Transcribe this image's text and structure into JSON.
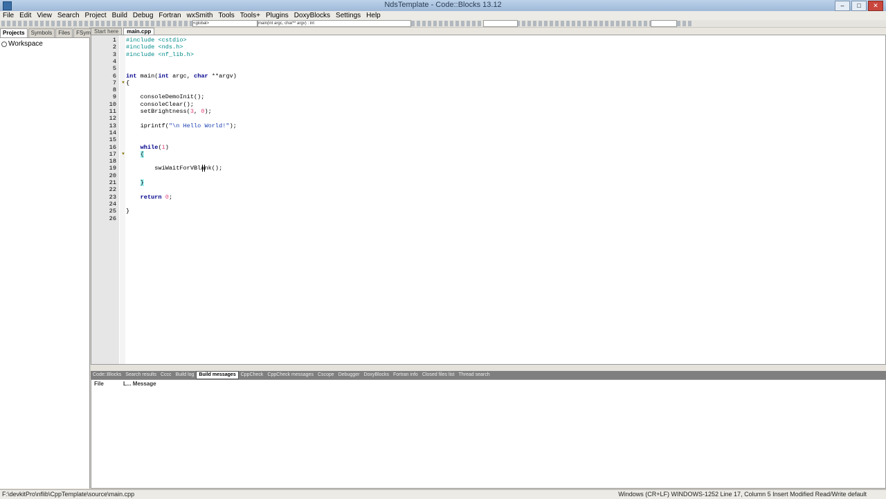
{
  "window": {
    "title": "NdsTemplate - Code::Blocks 13.12",
    "minimize_glyph": "–",
    "maximize_glyph": "□",
    "close_glyph": "✕"
  },
  "menu": [
    "File",
    "Edit",
    "View",
    "Search",
    "Project",
    "Build",
    "Debug",
    "Fortran",
    "wxSmith",
    "Tools",
    "Tools+",
    "Plugins",
    "DoxyBlocks",
    "Settings",
    "Help"
  ],
  "toolbar": {
    "build_target": "<global>",
    "function_combo": "main(int argc, char** argv) : int"
  },
  "left_panel": {
    "tabs": [
      "Projects",
      "Symbols",
      "Files",
      "FSymbols"
    ],
    "active_tab": "Projects",
    "tree_root": "Workspace"
  },
  "editor": {
    "tabs": [
      "Start here",
      "main.cpp"
    ],
    "active_tab": "main.cpp",
    "lines": [
      {
        "n": "1",
        "fold": "",
        "tokens": [
          {
            "c": "pp",
            "t": "#include <cstdio>"
          }
        ]
      },
      {
        "n": "2",
        "fold": "",
        "tokens": [
          {
            "c": "pp",
            "t": "#include <nds.h>"
          }
        ]
      },
      {
        "n": "3",
        "fold": "",
        "tokens": [
          {
            "c": "pp",
            "t": "#include <nf_lib.h>"
          }
        ]
      },
      {
        "n": "4",
        "fold": "",
        "tokens": []
      },
      {
        "n": "5",
        "fold": "",
        "tokens": []
      },
      {
        "n": "6",
        "fold": "",
        "tokens": [
          {
            "c": "kw",
            "t": "int"
          },
          {
            "c": "txt",
            "t": " main("
          },
          {
            "c": "kw",
            "t": "int"
          },
          {
            "c": "txt",
            "t": " argc, "
          },
          {
            "c": "kw",
            "t": "char"
          },
          {
            "c": "txt",
            "t": " **argv)"
          }
        ]
      },
      {
        "n": "7",
        "fold": "▾",
        "tokens": [
          {
            "c": "txt",
            "t": "{"
          }
        ]
      },
      {
        "n": "8",
        "fold": "",
        "tokens": []
      },
      {
        "n": "9",
        "fold": "",
        "tokens": [
          {
            "c": "txt",
            "t": "    consoleDemoInit();"
          }
        ]
      },
      {
        "n": "10",
        "fold": "",
        "tokens": [
          {
            "c": "txt",
            "t": "    consoleClear();"
          }
        ]
      },
      {
        "n": "11",
        "fold": "",
        "tokens": [
          {
            "c": "txt",
            "t": "    setBrightness("
          },
          {
            "c": "num",
            "t": "3"
          },
          {
            "c": "txt",
            "t": ", "
          },
          {
            "c": "num",
            "t": "0"
          },
          {
            "c": "txt",
            "t": ");"
          }
        ]
      },
      {
        "n": "12",
        "fold": "",
        "tokens": []
      },
      {
        "n": "13",
        "fold": "",
        "tokens": [
          {
            "c": "txt",
            "t": "    iprintf("
          },
          {
            "c": "str",
            "t": "\"\\n Hello World!\""
          },
          {
            "c": "txt",
            "t": ");"
          }
        ]
      },
      {
        "n": "14",
        "fold": "",
        "tokens": []
      },
      {
        "n": "15",
        "fold": "",
        "tokens": []
      },
      {
        "n": "16",
        "fold": "",
        "tokens": [
          {
            "c": "txt",
            "t": "    "
          },
          {
            "c": "kw",
            "t": "while"
          },
          {
            "c": "txt",
            "t": "("
          },
          {
            "c": "num",
            "t": "1"
          },
          {
            "c": "txt",
            "t": ")"
          }
        ]
      },
      {
        "n": "17",
        "fold": "▾",
        "tokens": [
          {
            "c": "txt",
            "t": "    "
          },
          {
            "c": "brace",
            "t": "{"
          }
        ]
      },
      {
        "n": "18",
        "fold": "",
        "tokens": []
      },
      {
        "n": "19",
        "fold": "",
        "tokens": [
          {
            "c": "txt",
            "t": "        swiWaitForVBlank();"
          }
        ]
      },
      {
        "n": "20",
        "fold": "",
        "tokens": []
      },
      {
        "n": "21",
        "fold": "",
        "tokens": [
          {
            "c": "txt",
            "t": "    "
          },
          {
            "c": "brace",
            "t": "}"
          }
        ]
      },
      {
        "n": "22",
        "fold": "",
        "tokens": []
      },
      {
        "n": "23",
        "fold": "",
        "tokens": [
          {
            "c": "txt",
            "t": "    "
          },
          {
            "c": "kw",
            "t": "return"
          },
          {
            "c": "txt",
            "t": " "
          },
          {
            "c": "num",
            "t": "0"
          },
          {
            "c": "txt",
            "t": ";"
          }
        ]
      },
      {
        "n": "24",
        "fold": "",
        "tokens": []
      },
      {
        "n": "25",
        "fold": "",
        "tokens": [
          {
            "c": "txt",
            "t": "}"
          }
        ]
      },
      {
        "n": "26",
        "fold": "",
        "tokens": []
      }
    ]
  },
  "logs": {
    "tabs": [
      "Code::Blocks",
      "Search results",
      "Cccc",
      "Build log",
      "Build messages",
      "CppCheck",
      "CppCheck messages",
      "Cscope",
      "Debugger",
      "DoxyBlocks",
      "Fortran info",
      "Closed files list",
      "Thread search"
    ],
    "active_tab": "Build messages",
    "columns": {
      "file": "File",
      "message": "L... Message"
    }
  },
  "status": {
    "path": "F:\\devkitPro\\nflib\\CppTemplate\\source\\main.cpp",
    "right": "Windows (CR+LF)   WINDOWS-1252   Line 17, Column 5   Insert   Modified   Read/Write   default"
  }
}
